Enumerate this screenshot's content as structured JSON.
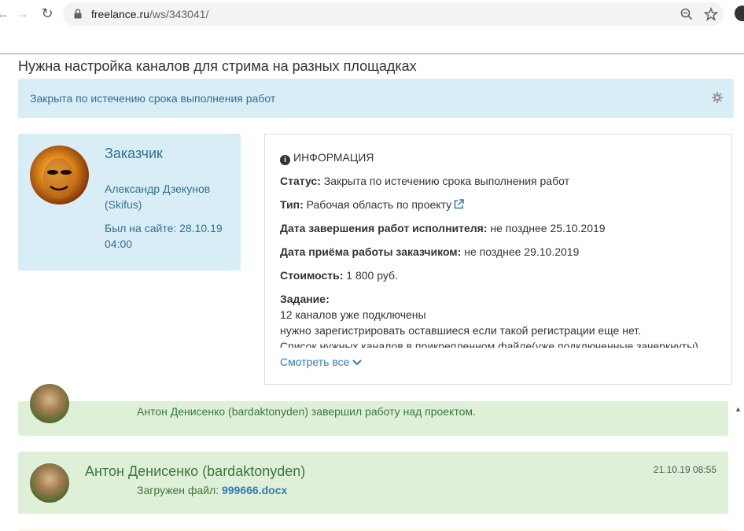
{
  "browser": {
    "url_host": "freelance.ru",
    "url_path": "/ws/343041/"
  },
  "page": {
    "title": "Нужна настройка каналов для стрима на разных площадках",
    "status": "Закрыта по истечению срока выполнения работ"
  },
  "client": {
    "heading": "Заказчик",
    "name": "Александр Дзекунов (Skifus)",
    "last_seen": "Был на сайте: 28.10.19 04:00"
  },
  "info": {
    "heading": "ИНФОРМАЦИЯ",
    "status_label": "Статус:",
    "status_value": " Закрыта по истечению срока выполнения работ",
    "type_label": "Тип:",
    "type_value": " Рабочая область по проекту",
    "deadline_label": "Дата завершения работ исполнителя:",
    "deadline_value": " не позднее 25.10.2019",
    "accept_label": "Дата приёма работы заказчиком:",
    "accept_value": " не позднее 29.10.2019",
    "cost_label": "Стоимость:",
    "cost_value": " 1 800 руб.",
    "task_label": "Задание:",
    "task_lines": [
      "12 каналов уже подключены",
      "нужно зарегистрировать оставшиеся если такой регистрации еще нет.",
      "Список нужных каналов в прикрепленном файле(уже подключенные зачеркнуты)"
    ],
    "see_all": "Смотреть все"
  },
  "events": [
    {
      "text": "Антон Денисенко (bardaktonyden) завершил работу над проектом."
    },
    {
      "author": "Антон Денисенко (bardaktonyden)",
      "time": "21.10.19 08:55",
      "file_label": "Загружен файл:",
      "file_name": "999666.docx"
    }
  ],
  "colors": {
    "info_bg": "#d9edf7",
    "info_text": "#31708f",
    "success_bg": "#dff0d8",
    "success_text": "#3c763d",
    "link": "#337ab7"
  }
}
